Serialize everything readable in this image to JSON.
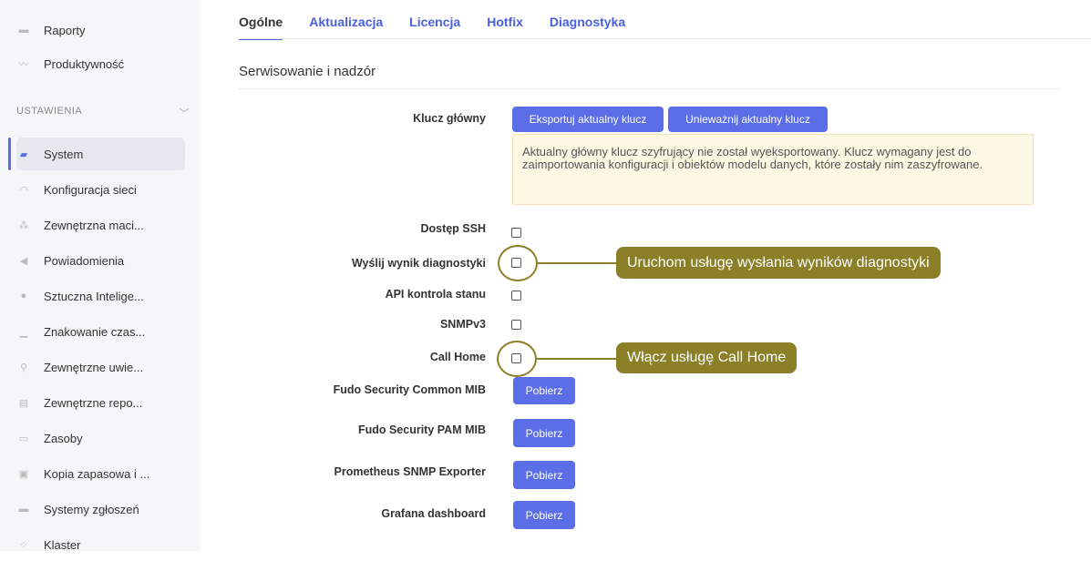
{
  "sidebar": {
    "items_top": [
      {
        "label": "Raporty",
        "icon": "printer-icon"
      },
      {
        "label": "Produktywność",
        "icon": "chart-icon"
      }
    ],
    "section_header": "USTAWIENIA",
    "items": [
      {
        "label": "System",
        "icon": "folder-icon"
      },
      {
        "label": "Konfiguracja sieci",
        "icon": "network-icon"
      },
      {
        "label": "Zewnętrzna maci...",
        "icon": "hierarchy-icon"
      },
      {
        "label": "Powiadomienia",
        "icon": "megaphone-icon"
      },
      {
        "label": "Sztuczna Intelige...",
        "icon": "brain-icon"
      },
      {
        "label": "Znakowanie czas...",
        "icon": "stamp-icon"
      },
      {
        "label": "Zewnętrzne uwie...",
        "icon": "key-icon"
      },
      {
        "label": "Zewnętrzne repo...",
        "icon": "storage-icon"
      },
      {
        "label": "Zasoby",
        "icon": "image-icon"
      },
      {
        "label": "Kopia zapasowa i ...",
        "icon": "backup-icon"
      },
      {
        "label": "Systemy zgłoszeń",
        "icon": "ticket-icon"
      },
      {
        "label": "Klaster",
        "icon": "cluster-icon"
      }
    ]
  },
  "tabs": [
    "Ogólne",
    "Aktualizacja",
    "Licencja",
    "Hotfix",
    "Diagnostyka"
  ],
  "section_title": "Serwisowanie i nadzór",
  "master_key": {
    "label": "Klucz główny",
    "export_button": "Eksportuj aktualny klucz",
    "invalidate_button": "Unieważnij aktualny klucz",
    "notice": "Aktualny główny klucz szyfrujący nie został wyeksportowany. Klucz wymagany jest do zaimportowania konfiguracji i obiektów modelu danych, które zostały nim zaszyfrowane."
  },
  "options": {
    "ssh": "Dostęp SSH",
    "diagnostics": "Wyślij wynik diagnostyki",
    "api_health": "API kontrola stanu",
    "snmpv3": "SNMPv3",
    "call_home": "Call Home"
  },
  "downloads": {
    "common_mib": "Fudo Security Common MIB",
    "pam_mib": "Fudo Security PAM MIB",
    "prometheus": "Prometheus SNMP Exporter",
    "grafana": "Grafana dashboard",
    "button": "Pobierz"
  },
  "callouts": {
    "diagnostics": "Uruchom usługę wysłania wyników diagnostyki",
    "call_home": "Włącz usługę Call Home"
  },
  "colors": {
    "accent": "#5b6ee8",
    "callout": "#8b7f28",
    "notice_bg": "#fcf8e3"
  }
}
